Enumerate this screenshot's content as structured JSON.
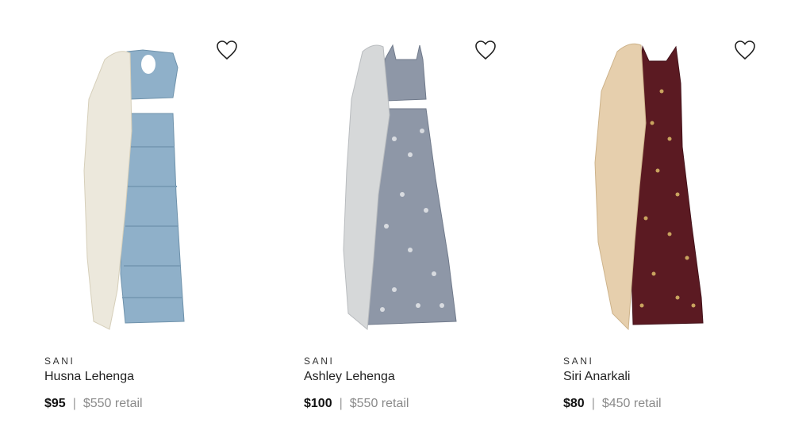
{
  "products": [
    {
      "brand": "SANI",
      "name": "Husna Lehenga",
      "price": "$95",
      "separator": "|",
      "retail": "$550 retail",
      "icon": "heart-outline",
      "colors": {
        "garment": "#8fb0c9",
        "dupatta": "#ece8dc"
      }
    },
    {
      "brand": "SANI",
      "name": "Ashley Lehenga",
      "price": "$100",
      "separator": "|",
      "retail": "$550 retail",
      "icon": "heart-outline",
      "colors": {
        "garment": "#8e97a7",
        "dupatta": "#d6d8d9"
      }
    },
    {
      "brand": "SANI",
      "name": "Siri Anarkali",
      "price": "$80",
      "separator": "|",
      "retail": "$450 retail",
      "icon": "heart-outline",
      "colors": {
        "garment": "#5b1a22",
        "dupatta": "#e6cfad"
      }
    }
  ]
}
